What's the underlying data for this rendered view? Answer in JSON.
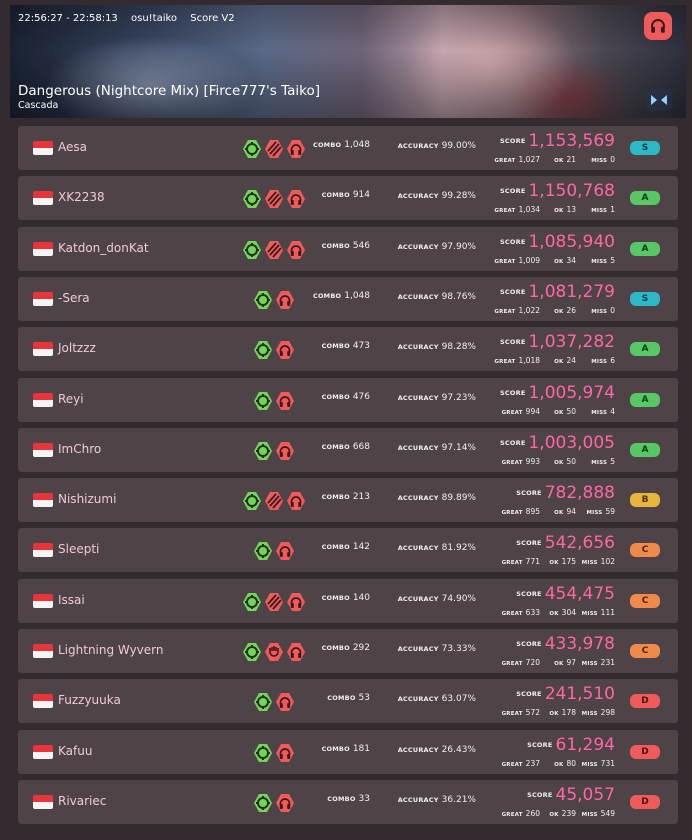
{
  "header": {
    "time_range": "22:56:27 - 22:58:13",
    "mode": "osu!taiko",
    "score_type": "Score V2",
    "title": "Dangerous (Nightcore Mix) [Firce777's Taiko]",
    "artist": "Cascada",
    "mode_icon": "headphones-icon",
    "arrow_icon": "double-arrow-icon"
  },
  "labels": {
    "combo": "COMBO",
    "accuracy": "ACCURACY",
    "score": "SCORE",
    "great": "GREAT",
    "ok": "OK",
    "miss": "MISS"
  },
  "colors": {
    "score_pink": "#ff66a6",
    "grade_S": "#2bb9c8",
    "grade_A": "#58c765",
    "grade_B": "#e9b53d",
    "grade_C": "#f08a4a",
    "grade_D": "#ef5b5b",
    "mod_green": "#73d65a",
    "mod_red": "#ef5b5b"
  },
  "rows": [
    {
      "name": "Aesa",
      "mods": [
        "nofail",
        "hidden",
        "nightcore"
      ],
      "combo": "1,048",
      "accuracy": "99.00%",
      "score": "1,153,569",
      "great": "1,027",
      "ok": "21",
      "miss": "0",
      "grade": "S"
    },
    {
      "name": "XK2238",
      "mods": [
        "nofail",
        "hidden",
        "nightcore"
      ],
      "combo": "914",
      "accuracy": "99.28%",
      "score": "1,150,768",
      "great": "1,034",
      "ok": "13",
      "miss": "1",
      "grade": "A"
    },
    {
      "name": "Katdon_donKat",
      "mods": [
        "nofail",
        "hidden",
        "nightcore"
      ],
      "combo": "546",
      "accuracy": "97.90%",
      "score": "1,085,940",
      "great": "1,009",
      "ok": "34",
      "miss": "5",
      "grade": "A"
    },
    {
      "name": "-Sera",
      "mods": [
        "nofail",
        "nightcore"
      ],
      "combo": "1,048",
      "accuracy": "98.76%",
      "score": "1,081,279",
      "great": "1,022",
      "ok": "26",
      "miss": "0",
      "grade": "S"
    },
    {
      "name": "Joltzzz",
      "mods": [
        "nofail",
        "nightcore"
      ],
      "combo": "473",
      "accuracy": "98.28%",
      "score": "1,037,282",
      "great": "1,018",
      "ok": "24",
      "miss": "6",
      "grade": "A"
    },
    {
      "name": "Reyi",
      "mods": [
        "nofail",
        "nightcore"
      ],
      "combo": "476",
      "accuracy": "97.23%",
      "score": "1,005,974",
      "great": "994",
      "ok": "50",
      "miss": "4",
      "grade": "A"
    },
    {
      "name": "ImChro",
      "mods": [
        "nofail",
        "nightcore"
      ],
      "combo": "668",
      "accuracy": "97.14%",
      "score": "1,003,005",
      "great": "993",
      "ok": "50",
      "miss": "5",
      "grade": "A"
    },
    {
      "name": "Nishizumi",
      "mods": [
        "nofail",
        "hidden",
        "nightcore"
      ],
      "combo": "213",
      "accuracy": "89.89%",
      "score": "782,888",
      "great": "895",
      "ok": "94",
      "miss": "59",
      "grade": "B"
    },
    {
      "name": "Sleepti",
      "mods": [
        "nofail",
        "nightcore"
      ],
      "combo": "142",
      "accuracy": "81.92%",
      "score": "542,656",
      "great": "771",
      "ok": "175",
      "miss": "102",
      "grade": "C"
    },
    {
      "name": "Issai",
      "mods": [
        "nofail",
        "hidden",
        "nightcore"
      ],
      "combo": "140",
      "accuracy": "74.90%",
      "score": "454,475",
      "great": "633",
      "ok": "304",
      "miss": "111",
      "grade": "C"
    },
    {
      "name": "Lightning Wyvern",
      "mods": [
        "nofail",
        "flashlight",
        "nightcore"
      ],
      "combo": "292",
      "accuracy": "73.33%",
      "score": "433,978",
      "great": "720",
      "ok": "97",
      "miss": "231",
      "grade": "C"
    },
    {
      "name": "Fuzzyuuka",
      "mods": [
        "nofail",
        "nightcore"
      ],
      "combo": "53",
      "accuracy": "63.07%",
      "score": "241,510",
      "great": "572",
      "ok": "178",
      "miss": "298",
      "grade": "D"
    },
    {
      "name": "Kafuu",
      "mods": [
        "nofail",
        "nightcore"
      ],
      "combo": "181",
      "accuracy": "26.43%",
      "score": "61,294",
      "great": "237",
      "ok": "80",
      "miss": "731",
      "grade": "D"
    },
    {
      "name": "Rivariec",
      "mods": [
        "nofail",
        "nightcore"
      ],
      "combo": "33",
      "accuracy": "36.21%",
      "score": "45,057",
      "great": "260",
      "ok": "239",
      "miss": "549",
      "grade": "D"
    }
  ]
}
